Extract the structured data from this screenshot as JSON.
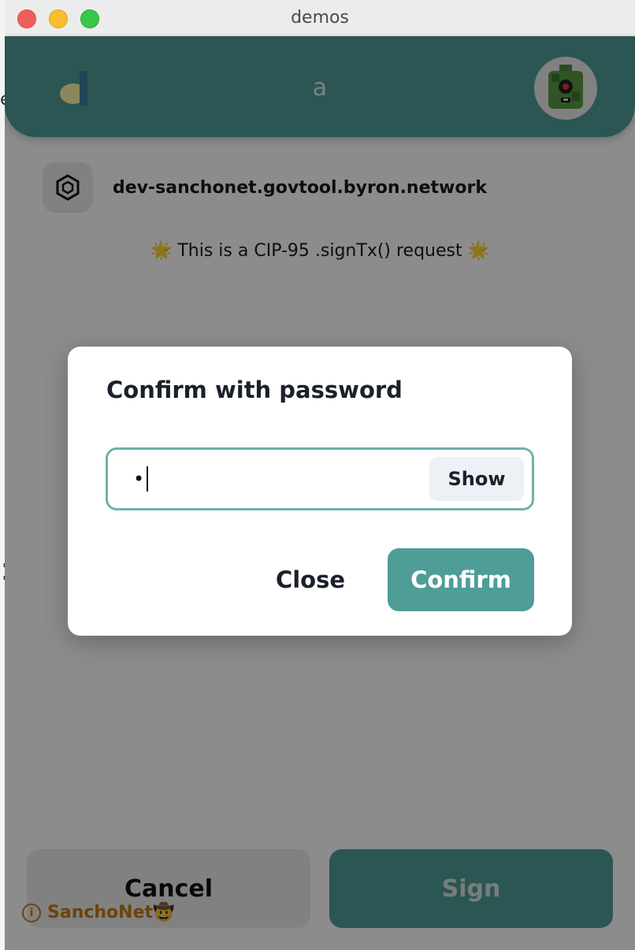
{
  "window": {
    "title": "demos"
  },
  "header": {
    "title": "a",
    "avatar_icon": "robot-avatar-icon"
  },
  "site": {
    "icon": "network-hex-icon",
    "url": "dev-sanchonet.govtool.byron.network"
  },
  "request": {
    "text": "🌟 This is a CIP-95 .signTx() request 🌟"
  },
  "modal": {
    "title": "Confirm with password",
    "password_value": "•",
    "show_label": "Show",
    "close_label": "Close",
    "confirm_label": "Confirm"
  },
  "actions": {
    "cancel_label": "Cancel",
    "sign_label": "Sign"
  },
  "network": {
    "icon": "info-icon",
    "label": "SanchoNet🤠"
  },
  "colors": {
    "accent": "#4f9d97",
    "header": "#4f9d97",
    "network_badge": "#c77a10"
  }
}
